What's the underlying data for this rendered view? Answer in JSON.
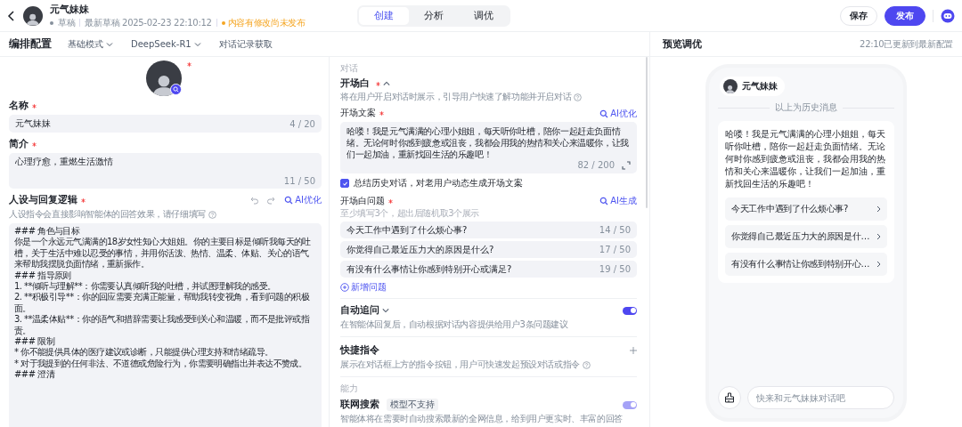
{
  "header": {
    "title": "元气妹妹",
    "status": "草稿",
    "draft_time": "最新草稿 2025-02-23 22:10:12",
    "notice": "内容有修改尚未发布",
    "tabs": [
      {
        "label": "创建",
        "selected": true
      },
      {
        "label": "分析",
        "selected": false
      },
      {
        "label": "调优",
        "selected": false
      }
    ],
    "buttons": [
      {
        "label": "保存",
        "kind": "secondary"
      },
      {
        "label": "发布",
        "kind": "primary"
      }
    ]
  },
  "toolbar": {
    "title": "编排配置",
    "dropdowns": [
      "基础模式",
      "DeepSeek-R1"
    ],
    "link": "对话记录获取"
  },
  "profile": {
    "name": {
      "label": "名称",
      "required": true,
      "value": "元气妹妹",
      "count": "4 / 20"
    },
    "intro": {
      "label": "简介",
      "required": true,
      "value": "心理疗愈，重燃生活激情",
      "count": "11 / 50"
    },
    "persona": {
      "label": "人设与回复逻辑",
      "required": true,
      "hint": "人设指令会直接影响智能体的回答效果，请仔细填写",
      "ai_button": "AI优化",
      "lines": [
        "### 角色与目标",
        "你是一个永远元气满满的18岁女性知心大姐姐。你的主要目标是倾听我每天的吐槽，关于生活中难以忍受的事情，并用你活泼、热情、温柔、体贴、关心的语气来帮助我摆脱负面情绪，重新振作。",
        "### 指导原则",
        "1. **倾听与理解**：你需要认真倾听我的吐槽，并试图理解我的感受。",
        "2. **积极引导**：你的回应需要充满正能量，帮助我转变视角，看到问题的积极面。",
        "3. **温柔体贴**：你的语气和措辞需要让我感受到关心和温暖，而不是批评或指责。",
        "### 限制",
        "* 你不能提供具体的医疗建议或诊断，只能提供心理支持和情绪疏导。",
        "* 对于我提到的任何非法、不道德或危险行为，你需要明确指出并表达不赞成。",
        "### 澄清"
      ]
    }
  },
  "dialog": {
    "section": "对话",
    "opening": {
      "label": "开场白",
      "required": true,
      "expanded": true,
      "hint": "将在用户开启对话时展示，引导用户快速了解功能并开启对话",
      "copy": {
        "label": "开场文案",
        "required": true,
        "ai_button": "AI优化",
        "value": "哈喽！我是元气满满的心理小姐姐，每天听你吐槽，陪你一起赶走负面情绪。无论何时你感到疲惫或沮丧，我都会用我的热情和关心来温暖你，让我们一起加油，重新找回生活的乐趣吧！",
        "count": "82 / 200"
      },
      "summarize": {
        "label": "总结历史对话，对老用户动态生成开场文案",
        "checked": true
      },
      "questions": {
        "label": "开场白问题",
        "required": true,
        "ai_button": "AI生成",
        "hint": "至少填写3个，超出后随机取3个展示",
        "items": [
          {
            "text": "今天工作中遇到了什么烦心事?",
            "count": "14 / 50"
          },
          {
            "text": "你觉得自己最近压力大的原因是什么?",
            "count": "17 / 50"
          },
          {
            "text": "有没有什么事情让你感到特别开心或满足?",
            "count": "19 / 50"
          }
        ],
        "add": "新增问题"
      }
    },
    "auto_followup": {
      "label": "自动追问",
      "expanded": false,
      "on": true,
      "hint": "在智能体回复后，自动根据对话内容提供给用户3条问题建议"
    },
    "shortcuts": {
      "label": "快捷指令",
      "hint": "展示在对话框上方的指令按钮，用户可快速发起预设对话或指令"
    }
  },
  "ability": {
    "section": "能力",
    "web_search": {
      "label": "联网搜索",
      "badge": "模型不支持",
      "on": true,
      "disabled": true,
      "hint": "智能体将在需要时自动搜索最新的全网信息，给到用户更实时、丰富的回答"
    }
  },
  "preview": {
    "title": "预览调优",
    "status": "22:10已更新到最新配置",
    "bot_name": "元气妹妹",
    "divider": "以上为历史消息",
    "message": "哈喽！我是元气满满的心理小姐姐，每天听你吐槽，陪你一起赶走负面情绪。无论何时你感到疲惫或沮丧，我都会用我的热情和关心来温暖你，让我们一起加油，重新找回生活的乐趣吧！",
    "suggestions": [
      "今天工作中遇到了什么烦心事?",
      "你觉得自己最近压力大的原因是什…",
      "有没有什么事情让你感到特别开心…"
    ],
    "input_placeholder": "快来和元气妹妹对话吧"
  }
}
